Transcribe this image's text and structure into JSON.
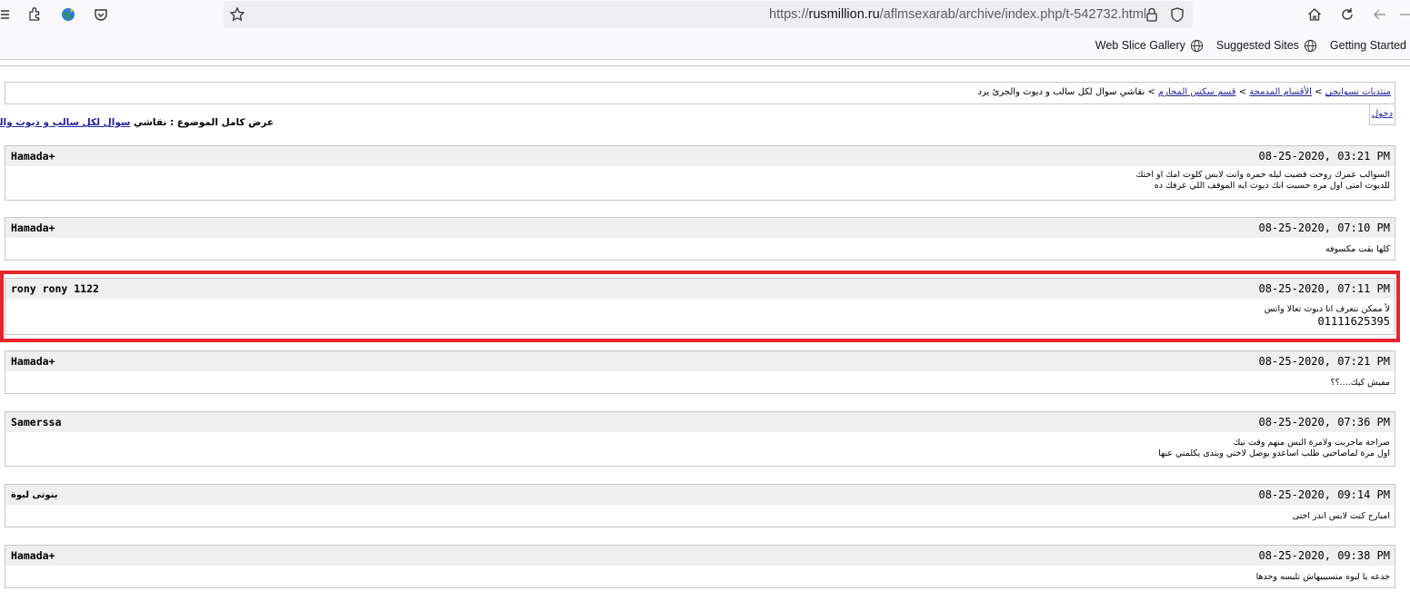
{
  "browser": {
    "url_prefix": "https://",
    "url_host": "rusmillion.ru",
    "url_path": "/aflmsexarab/archive/index.php/t-542732.html",
    "bookmarks": [
      "Web Slice Gallery",
      "Suggested Sites",
      "Getting Started"
    ]
  },
  "nav": {
    "crumbs": [
      "منتديات نسوانجي",
      "الأقسام المدمجة",
      "قسم سكس المحارم"
    ],
    "current": "نقاشي سوال لكل سالب و ديوث والجرئ يرد",
    "sep": ">"
  },
  "login": "دخول",
  "topic": {
    "prefix": "عرض كامل الموضوع : نقاشي",
    "link": "سوال لكل سالب و ديوث والجرى يرد"
  },
  "posts": [
    {
      "author": "Hamada+",
      "date": "08-25-2020, 03:21 PM",
      "lines": [
        "السوالب عمرك روحت قضيت ليله حمره وانت لابس كلوت امك او اختك",
        "للديوث امتى اول مره حسيت انك ديوث ايه الموقف اللي عرفك ده"
      ]
    },
    {
      "author": "Hamada+",
      "date": "08-25-2020, 07:10 PM",
      "lines": [
        "كلها بقت مكسوفه"
      ]
    },
    {
      "author": "rony rony 1122",
      "date": "08-25-2020, 07:11 PM",
      "lines": [
        "لأ ممكن نتعرف انا ديوث تعالا واتس"
      ],
      "phone": "01111625395"
    },
    {
      "author": "Hamada+",
      "date": "08-25-2020, 07:21 PM",
      "lines": [
        "مفيش كيك....؟؟"
      ]
    },
    {
      "author": "Samerssa",
      "date": "08-25-2020, 07:36 PM",
      "lines": [
        "صراحة ماجربت ولامرة البس منهم وقت نيك",
        "اول مرة لماصاحبي طلب اساعدو يوصل لاختي وبتدى يكلمني عنها"
      ]
    },
    {
      "author": "بنوتى لبوة",
      "date": "08-25-2020, 09:14 PM",
      "lines": [
        "امبارح كنت لابس اندر اختى"
      ]
    },
    {
      "author": "Hamada+",
      "date": "08-25-2020, 09:38 PM",
      "lines": [
        "جدعه يا لبوه متسيبيهاش تلبسه وحدها"
      ]
    }
  ],
  "colors": {
    "highlight": "#e8242b",
    "link": "#22229c",
    "header_bg": "#efefef"
  }
}
